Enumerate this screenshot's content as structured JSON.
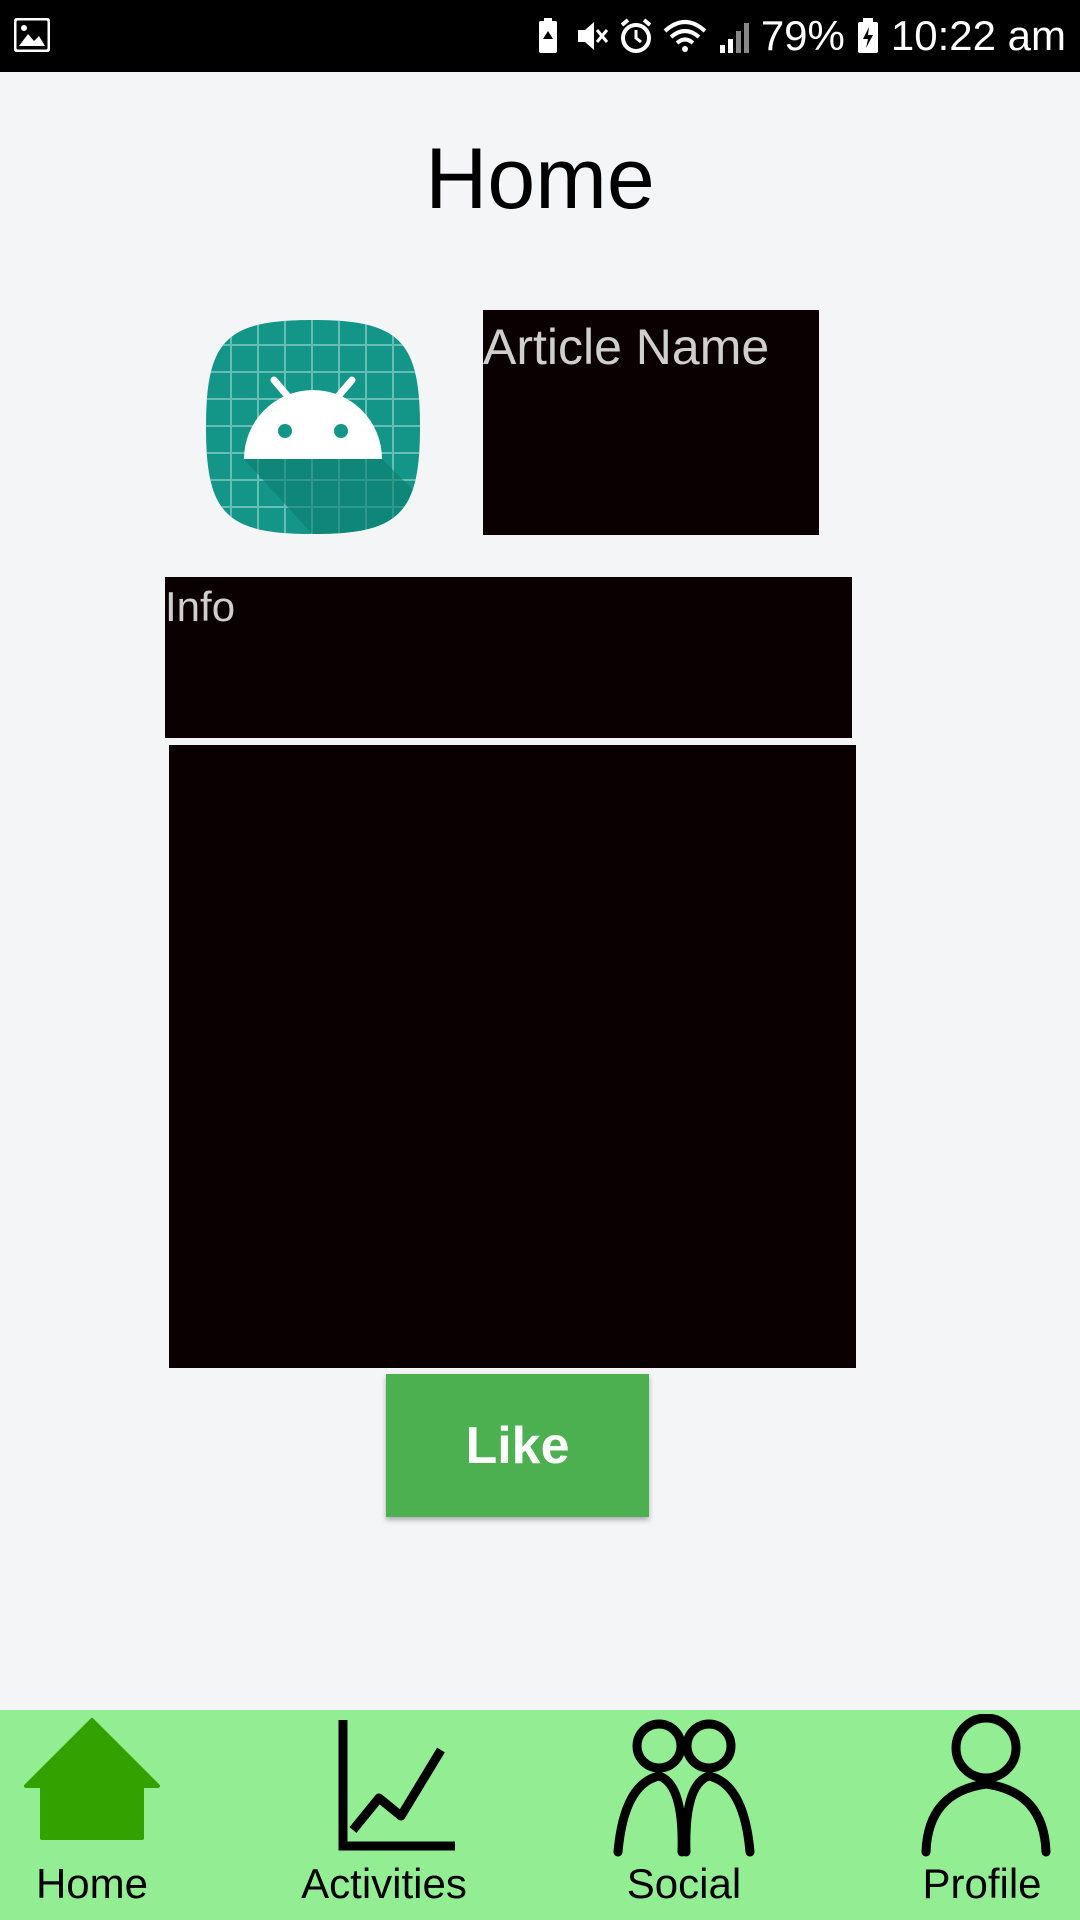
{
  "status_bar": {
    "battery": "79%",
    "time": "10:22 am",
    "icons": [
      "gallery-icon",
      "battery-saver-icon",
      "mute-icon",
      "alarm-icon",
      "wifi-icon",
      "signal-icon",
      "battery-icon"
    ]
  },
  "page": {
    "title": "Home"
  },
  "article": {
    "icon": "android-app-icon",
    "name_label": "Article Name",
    "info_label": "Info"
  },
  "actions": {
    "like_label": "Like"
  },
  "bottom_nav": {
    "background": "#93ee93",
    "items": [
      {
        "label": "Home",
        "icon": "home-icon",
        "color": "#33a100"
      },
      {
        "label": "Activities",
        "icon": "chart-icon",
        "color": "#000000"
      },
      {
        "label": "Social",
        "icon": "people-icon",
        "color": "#000000"
      },
      {
        "label": "Profile",
        "icon": "person-icon",
        "color": "#000000"
      }
    ]
  }
}
